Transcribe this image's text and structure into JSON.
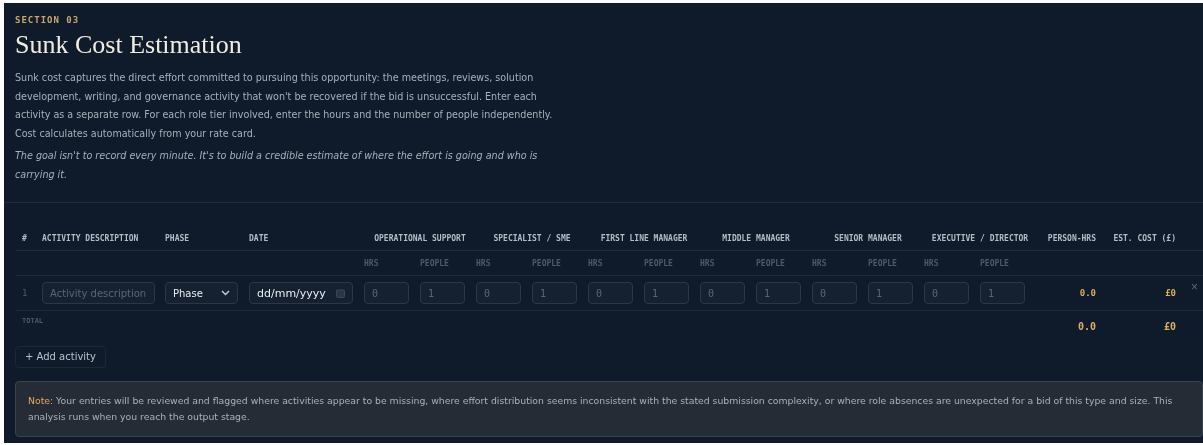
{
  "section_label": "SECTION 03",
  "title": "Sunk Cost Estimation",
  "paragraphs": [
    {
      "kind": "body",
      "text": "Sunk cost captures the direct effort committed to pursuing this opportunity: the meetings, reviews, solution development, writing, and governance activity that won't be recovered if the bid is unsuccessful. Enter each activity as a separate row. For each role tier involved, enter the hours and the number of people independently. Cost calculates automatically from your rate card."
    },
    {
      "kind": "emphasis",
      "text": "The goal isn't to record every minute. It's to build a credible estimate of where the effort is going and who is carrying it."
    }
  ],
  "table": {
    "columns": [
      "#",
      "ACTIVITY DESCRIPTION",
      "PHASE",
      "DATE"
    ],
    "role_groups": [
      {
        "label": "OPERATIONAL SUPPORT",
        "subcolumns": [
          "HRS",
          "PEOPLE"
        ]
      },
      {
        "label": "SPECIALIST / SME",
        "subcolumns": [
          "HRS",
          "PEOPLE"
        ]
      },
      {
        "label": "FIRST LINE MANAGER",
        "subcolumns": [
          "HRS",
          "PEOPLE"
        ]
      },
      {
        "label": "MIDDLE MANAGER",
        "subcolumns": [
          "HRS",
          "PEOPLE"
        ]
      },
      {
        "label": "SENIOR MANAGER",
        "subcolumns": [
          "HRS",
          "PEOPLE"
        ]
      },
      {
        "label": "EXECUTIVE / DIRECTOR",
        "subcolumns": [
          "HRS",
          "PEOPLE"
        ]
      }
    ],
    "summary_columns": [
      "PERSON-HRS",
      "EST. COST (£)"
    ],
    "rows": [
      {
        "number": "1",
        "description": {
          "placeholder": "Activity description"
        },
        "phase": {
          "value": "Phase"
        },
        "date": {
          "value": "dd/mm/yyyy"
        },
        "roles": [
          {
            "hrs": {
              "placeholder": "0"
            },
            "people": {
              "placeholder": "1"
            }
          },
          {
            "hrs": {
              "placeholder": "0"
            },
            "people": {
              "placeholder": "1"
            }
          },
          {
            "hrs": {
              "placeholder": "0"
            },
            "people": {
              "placeholder": "1"
            }
          },
          {
            "hrs": {
              "placeholder": "0"
            },
            "people": {
              "placeholder": "1"
            }
          },
          {
            "hrs": {
              "placeholder": "0"
            },
            "people": {
              "placeholder": "1"
            }
          },
          {
            "hrs": {
              "placeholder": "0"
            },
            "people": {
              "placeholder": "1"
            }
          }
        ],
        "person_hrs": "0.0",
        "est_cost": "£0",
        "remove": "×"
      }
    ],
    "total": {
      "label": "TOTAL",
      "person_hrs": "0.0",
      "est_cost": "£0"
    }
  },
  "add_button": "+ Add activity",
  "note": "**Note:** Your entries will be reviewed and flagged where activities appear to be missing, where effort distribution seems inconsistent with the stated submission complexity, or where role absences are unexpected for a bid of this type and size. This analysis runs when you reach the output stage."
}
